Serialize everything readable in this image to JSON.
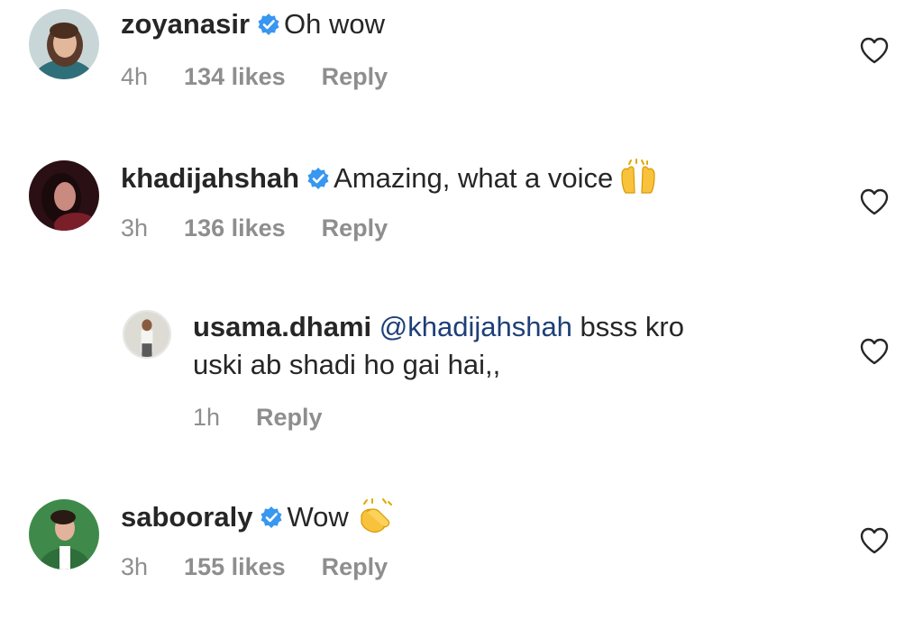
{
  "comments": [
    {
      "username": "zoyanasir",
      "verified": true,
      "text": "Oh wow",
      "time": "4h",
      "likes": "134 likes",
      "reply_label": "Reply",
      "avatar_icon": "avatar-zoyanasir"
    },
    {
      "username": "khadijahshah",
      "verified": true,
      "text": "Amazing, what a voice",
      "emoji": "raising-hands-icon",
      "time": "3h",
      "likes": "136 likes",
      "reply_label": "Reply",
      "avatar_icon": "avatar-khadijahshah"
    },
    {
      "username": "usama.dhami",
      "verified": false,
      "mention": "@khadijahshah",
      "text_line1": "bsss kro",
      "text_line2": "uski ab shadi ho gai hai,,",
      "time": "1h",
      "reply_label": "Reply",
      "avatar_icon": "avatar-usama-dhami"
    },
    {
      "username": "sabooraly",
      "verified": true,
      "text": "Wow",
      "emoji": "clapping-hands-icon",
      "time": "3h",
      "likes": "155 likes",
      "reply_label": "Reply",
      "avatar_icon": "avatar-sabooraly"
    }
  ],
  "colors": {
    "text": "#262626",
    "meta": "#8e8e8e",
    "verified": "#3897f0",
    "mention": "#1e3f78"
  }
}
